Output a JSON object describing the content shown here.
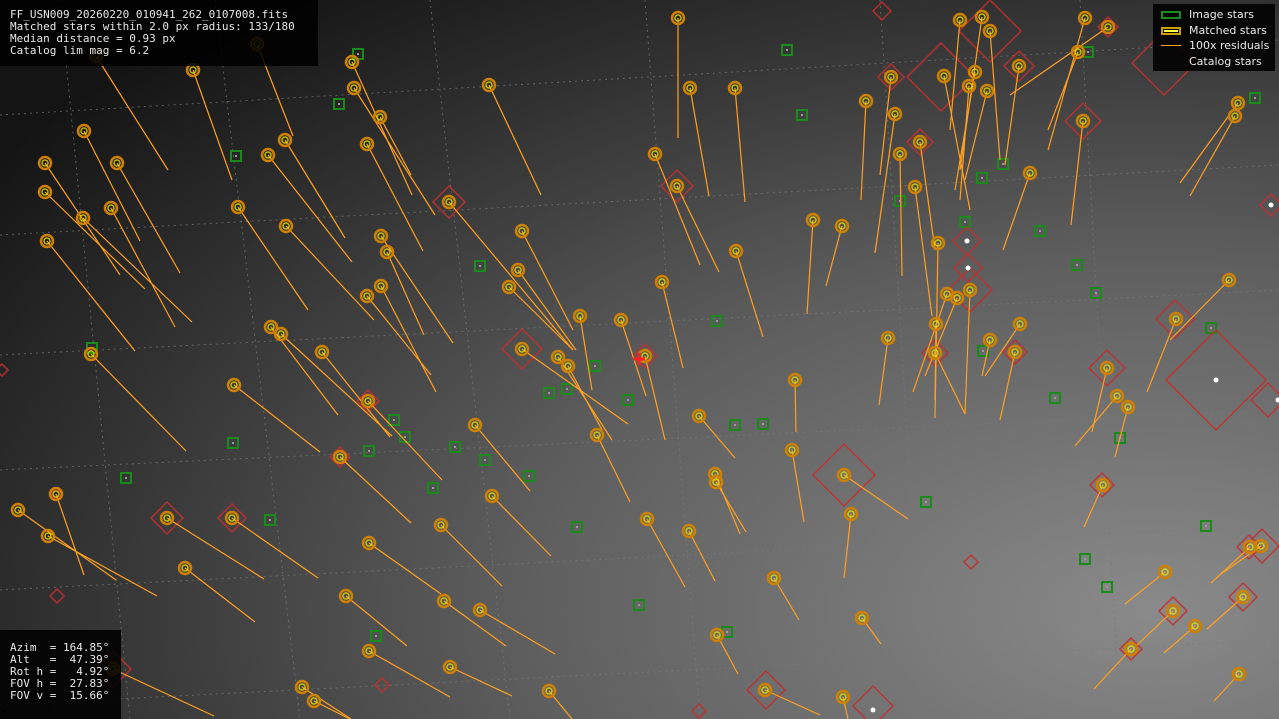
{
  "info": {
    "lines": [
      "FF_USN009_20260220_010941_262_0107008.fits",
      "Matched stars within 2.0 px radius: 133/180",
      "Median distance = 0.93 px",
      "Catalog lim mag = 6.2"
    ]
  },
  "legend": {
    "image_stars": "Image stars",
    "matched_stars": "Matched stars",
    "residuals": "100x residuals",
    "catalog_stars": "Catalog stars"
  },
  "coords": {
    "lines": [
      "Azim  = 164.85°",
      "Alt   =  47.39°",
      "Rot h =   4.92°",
      "FOV h =  27.83°",
      "FOV v =  15.66°"
    ]
  },
  "colors": {
    "image_star": "#1a8a1a",
    "matched_ring_outer": "#d08000",
    "matched_ring_inner": "#e8e000",
    "residual": "#ffa020",
    "catalog_star": "#c03030",
    "grid": "#7a7a7a",
    "marker": "#ff2020"
  },
  "matched_stars": [
    [
      678,
      18
    ],
    [
      960,
      20
    ],
    [
      982,
      17
    ],
    [
      990,
      31
    ],
    [
      1085,
      18
    ],
    [
      1108,
      27
    ],
    [
      1078,
      52
    ],
    [
      1019,
      66
    ],
    [
      944,
      76
    ],
    [
      975,
      72
    ],
    [
      969,
      86
    ],
    [
      987,
      91
    ],
    [
      866,
      101
    ],
    [
      891,
      77
    ],
    [
      895,
      114
    ],
    [
      920,
      142
    ],
    [
      900,
      154
    ],
    [
      1083,
      121
    ],
    [
      1030,
      173
    ],
    [
      915,
      187
    ],
    [
      938,
      243
    ],
    [
      947,
      294
    ],
    [
      957,
      298
    ],
    [
      970,
      290
    ],
    [
      936,
      324
    ],
    [
      935,
      353
    ],
    [
      1015,
      352
    ],
    [
      990,
      340
    ],
    [
      1020,
      324
    ],
    [
      888,
      338
    ],
    [
      795,
      380
    ],
    [
      842,
      226
    ],
    [
      813,
      220
    ],
    [
      735,
      88
    ],
    [
      690,
      88
    ],
    [
      655,
      154
    ],
    [
      677,
      186
    ],
    [
      736,
      251
    ],
    [
      662,
      282
    ],
    [
      621,
      320
    ],
    [
      645,
      356
    ],
    [
      558,
      357
    ],
    [
      568,
      366
    ],
    [
      580,
      316
    ],
    [
      522,
      231
    ],
    [
      518,
      270
    ],
    [
      509,
      287
    ],
    [
      449,
      202
    ],
    [
      489,
      85
    ],
    [
      352,
      62
    ],
    [
      354,
      88
    ],
    [
      380,
      117
    ],
    [
      367,
      144
    ],
    [
      285,
      140
    ],
    [
      268,
      155
    ],
    [
      238,
      207
    ],
    [
      286,
      226
    ],
    [
      381,
      236
    ],
    [
      387,
      252
    ],
    [
      381,
      286
    ],
    [
      367,
      296
    ],
    [
      193,
      70
    ],
    [
      257,
      44
    ],
    [
      96,
      56
    ],
    [
      84,
      131
    ],
    [
      117,
      163
    ],
    [
      45,
      163
    ],
    [
      45,
      192
    ],
    [
      83,
      218
    ],
    [
      111,
      208
    ],
    [
      47,
      241
    ],
    [
      91,
      354
    ],
    [
      271,
      327
    ],
    [
      281,
      334
    ],
    [
      322,
      352
    ],
    [
      234,
      385
    ],
    [
      368,
      401
    ],
    [
      340,
      457
    ],
    [
      475,
      425
    ],
    [
      522,
      349
    ],
    [
      597,
      435
    ],
    [
      699,
      416
    ],
    [
      715,
      474
    ],
    [
      716,
      482
    ],
    [
      792,
      450
    ],
    [
      844,
      475
    ],
    [
      851,
      514
    ],
    [
      689,
      531
    ],
    [
      647,
      519
    ],
    [
      774,
      578
    ],
    [
      717,
      635
    ],
    [
      862,
      618
    ],
    [
      843,
      697
    ],
    [
      765,
      690
    ],
    [
      549,
      691
    ],
    [
      450,
      667
    ],
    [
      480,
      610
    ],
    [
      444,
      601
    ],
    [
      369,
      651
    ],
    [
      346,
      596
    ],
    [
      369,
      543
    ],
    [
      441,
      525
    ],
    [
      492,
      496
    ],
    [
      302,
      687
    ],
    [
      314,
      701
    ],
    [
      232,
      518
    ],
    [
      167,
      518
    ],
    [
      185,
      568
    ],
    [
      56,
      494
    ],
    [
      48,
      536
    ],
    [
      18,
      510
    ],
    [
      113,
      669
    ],
    [
      1238,
      103
    ],
    [
      1235,
      116
    ],
    [
      1229,
      280
    ],
    [
      1176,
      319
    ],
    [
      1107,
      368
    ],
    [
      1117,
      396
    ],
    [
      1128,
      407
    ],
    [
      1103,
      485
    ],
    [
      1165,
      572
    ],
    [
      1250,
      547
    ],
    [
      1261,
      546
    ],
    [
      1243,
      597
    ],
    [
      1173,
      611
    ],
    [
      1195,
      626
    ],
    [
      1131,
      649
    ],
    [
      1239,
      674
    ]
  ],
  "residuals": [
    [
      678,
      18,
      678,
      138
    ],
    [
      960,
      20,
      950,
      130
    ],
    [
      982,
      17,
      960,
      170
    ],
    [
      990,
      31,
      1000,
      160
    ],
    [
      1085,
      18,
      1048,
      150
    ],
    [
      1108,
      27,
      1010,
      95
    ],
    [
      1078,
      52,
      1048,
      130
    ],
    [
      1019,
      66,
      1005,
      165
    ],
    [
      944,
      76,
      970,
      210
    ],
    [
      975,
      72,
      955,
      190
    ],
    [
      969,
      86,
      960,
      200
    ],
    [
      987,
      91,
      965,
      180
    ],
    [
      866,
      101,
      861,
      200
    ],
    [
      891,
      77,
      880,
      175
    ],
    [
      895,
      114,
      875,
      253
    ],
    [
      920,
      142,
      935,
      250
    ],
    [
      900,
      154,
      902,
      276
    ],
    [
      1083,
      121,
      1071,
      225
    ],
    [
      1030,
      173,
      1003,
      250
    ],
    [
      915,
      187,
      932,
      316
    ],
    [
      938,
      243,
      935,
      418
    ],
    [
      947,
      294,
      913,
      392
    ],
    [
      957,
      298,
      925,
      376
    ],
    [
      970,
      290,
      965,
      414
    ],
    [
      936,
      324,
      935,
      400
    ],
    [
      935,
      353,
      965,
      414
    ],
    [
      1015,
      352,
      1000,
      420
    ],
    [
      990,
      340,
      982,
      376
    ],
    [
      1020,
      324,
      985,
      376
    ],
    [
      888,
      338,
      879,
      405
    ],
    [
      795,
      380,
      796,
      432
    ],
    [
      842,
      226,
      826,
      286
    ],
    [
      813,
      220,
      807,
      314
    ],
    [
      735,
      88,
      745,
      202
    ],
    [
      690,
      88,
      709,
      196
    ],
    [
      655,
      154,
      700,
      265
    ],
    [
      677,
      186,
      719,
      272
    ],
    [
      736,
      251,
      763,
      337
    ],
    [
      662,
      282,
      683,
      368
    ],
    [
      621,
      320,
      646,
      396
    ],
    [
      645,
      356,
      665,
      440
    ],
    [
      558,
      357,
      612,
      440
    ],
    [
      568,
      366,
      602,
      430
    ],
    [
      580,
      316,
      592,
      390
    ],
    [
      522,
      231,
      573,
      330
    ],
    [
      518,
      270,
      576,
      350
    ],
    [
      509,
      287,
      573,
      350
    ],
    [
      449,
      202,
      573,
      350
    ],
    [
      489,
      85,
      541,
      195
    ],
    [
      352,
      62,
      412,
      195
    ],
    [
      354,
      88,
      435,
      215
    ],
    [
      380,
      117,
      411,
      175
    ],
    [
      367,
      144,
      423,
      251
    ],
    [
      285,
      140,
      345,
      238
    ],
    [
      268,
      155,
      352,
      262
    ],
    [
      238,
      207,
      308,
      310
    ],
    [
      286,
      226,
      374,
      320
    ],
    [
      381,
      236,
      453,
      343
    ],
    [
      387,
      252,
      424,
      335
    ],
    [
      381,
      286,
      436,
      392
    ],
    [
      367,
      296,
      431,
      375
    ],
    [
      193,
      70,
      232,
      180
    ],
    [
      257,
      44,
      293,
      136
    ],
    [
      96,
      56,
      168,
      170
    ],
    [
      84,
      131,
      140,
      241
    ],
    [
      117,
      163,
      180,
      273
    ],
    [
      45,
      163,
      120,
      275
    ],
    [
      45,
      192,
      145,
      289
    ],
    [
      83,
      218,
      192,
      322
    ],
    [
      111,
      208,
      175,
      327
    ],
    [
      47,
      241,
      135,
      351
    ],
    [
      91,
      354,
      186,
      451
    ],
    [
      271,
      327,
      338,
      415
    ],
    [
      281,
      334,
      392,
      436
    ],
    [
      322,
      352,
      390,
      437
    ],
    [
      234,
      385,
      320,
      452
    ],
    [
      368,
      401,
      442,
      480
    ],
    [
      340,
      457,
      411,
      523
    ],
    [
      475,
      425,
      530,
      491
    ],
    [
      522,
      349,
      628,
      424
    ],
    [
      597,
      435,
      630,
      502
    ],
    [
      699,
      416,
      735,
      458
    ],
    [
      715,
      474,
      740,
      534
    ],
    [
      716,
      482,
      746,
      532
    ],
    [
      792,
      450,
      804,
      522
    ],
    [
      844,
      475,
      908,
      519
    ],
    [
      851,
      514,
      844,
      578
    ],
    [
      689,
      531,
      715,
      581
    ],
    [
      647,
      519,
      685,
      587
    ],
    [
      774,
      578,
      799,
      620
    ],
    [
      717,
      635,
      738,
      674
    ],
    [
      862,
      618,
      881,
      644
    ],
    [
      843,
      697,
      848,
      719
    ],
    [
      765,
      690,
      820,
      715
    ],
    [
      549,
      691,
      572,
      719
    ],
    [
      450,
      667,
      512,
      696
    ],
    [
      480,
      610,
      555,
      654
    ],
    [
      444,
      601,
      506,
      646
    ],
    [
      369,
      651,
      450,
      697
    ],
    [
      346,
      596,
      407,
      646
    ],
    [
      369,
      543,
      441,
      594
    ],
    [
      441,
      525,
      502,
      586
    ],
    [
      492,
      496,
      551,
      556
    ],
    [
      302,
      687,
      351,
      719
    ],
    [
      314,
      701,
      350,
      719
    ],
    [
      232,
      518,
      318,
      578
    ],
    [
      167,
      518,
      264,
      579
    ],
    [
      185,
      568,
      255,
      622
    ],
    [
      56,
      494,
      84,
      575
    ],
    [
      48,
      536,
      157,
      596
    ],
    [
      18,
      510,
      116,
      580
    ],
    [
      113,
      669,
      214,
      716
    ],
    [
      1238,
      103,
      1180,
      183
    ],
    [
      1235,
      116,
      1190,
      196
    ],
    [
      1229,
      280,
      1170,
      340
    ],
    [
      1176,
      319,
      1147,
      392
    ],
    [
      1107,
      368,
      1092,
      432
    ],
    [
      1117,
      396,
      1075,
      446
    ],
    [
      1128,
      407,
      1115,
      457
    ],
    [
      1103,
      485,
      1084,
      527
    ],
    [
      1165,
      572,
      1125,
      604
    ],
    [
      1250,
      547,
      1211,
      583
    ],
    [
      1261,
      546,
      1221,
      574
    ],
    [
      1243,
      597,
      1207,
      629
    ],
    [
      1173,
      611,
      1137,
      645
    ],
    [
      1195,
      626,
      1164,
      653
    ],
    [
      1131,
      649,
      1094,
      689
    ],
    [
      1239,
      674,
      1214,
      701
    ]
  ],
  "image_stars": [
    [
      358,
      54
    ],
    [
      787,
      50
    ],
    [
      339,
      104
    ],
    [
      802,
      115
    ],
    [
      236,
      156
    ],
    [
      1003,
      164
    ],
    [
      982,
      178
    ],
    [
      900,
      201
    ],
    [
      965,
      222
    ],
    [
      1040,
      231
    ],
    [
      1077,
      265
    ],
    [
      480,
      266
    ],
    [
      1096,
      293
    ],
    [
      717,
      321
    ],
    [
      1211,
      328
    ],
    [
      92,
      348
    ],
    [
      983,
      351
    ],
    [
      595,
      366
    ],
    [
      549,
      393
    ],
    [
      567,
      389
    ],
    [
      628,
      400
    ],
    [
      1055,
      398
    ],
    [
      735,
      425
    ],
    [
      763,
      424
    ],
    [
      394,
      420
    ],
    [
      405,
      437
    ],
    [
      233,
      443
    ],
    [
      455,
      447
    ],
    [
      369,
      451
    ],
    [
      1120,
      438
    ],
    [
      485,
      460
    ],
    [
      529,
      476
    ],
    [
      126,
      478
    ],
    [
      433,
      488
    ],
    [
      926,
      502
    ],
    [
      270,
      520
    ],
    [
      577,
      527
    ],
    [
      1206,
      526
    ],
    [
      1085,
      559
    ],
    [
      1107,
      587
    ],
    [
      639,
      605
    ],
    [
      727,
      632
    ],
    [
      376,
      636
    ],
    [
      1255,
      98
    ],
    [
      1088,
      52
    ]
  ],
  "catalog_stars": [
    [
      449,
      202,
      16
    ],
    [
      522,
      349,
      20
    ],
    [
      368,
      401,
      11
    ],
    [
      340,
      457,
      10
    ],
    [
      167,
      518,
      16
    ],
    [
      232,
      518,
      14
    ],
    [
      844,
      475,
      31
    ],
    [
      766,
      690,
      19
    ],
    [
      873,
      706,
      20
    ],
    [
      1216,
      380,
      50
    ],
    [
      1175,
      319,
      19
    ],
    [
      1107,
      368,
      18
    ],
    [
      1102,
      485,
      12
    ],
    [
      1249,
      547,
      12
    ],
    [
      1262,
      546,
      17
    ],
    [
      1243,
      597,
      14
    ],
    [
      1173,
      611,
      14
    ],
    [
      1131,
      649,
      11
    ],
    [
      1268,
      400,
      17
    ],
    [
      1271,
      205,
      11
    ],
    [
      1083,
      121,
      18
    ],
    [
      1019,
      66,
      15
    ],
    [
      1164,
      63,
      32
    ],
    [
      990,
      31,
      31
    ],
    [
      941,
      77,
      34
    ],
    [
      891,
      77,
      13
    ],
    [
      920,
      142,
      13
    ],
    [
      967,
      241,
      14
    ],
    [
      968,
      268,
      14
    ],
    [
      970,
      290,
      22
    ],
    [
      1015,
      352,
      12
    ],
    [
      935,
      353,
      13
    ],
    [
      677,
      186,
      16
    ],
    [
      645,
      356,
      12
    ],
    [
      882,
      11,
      9
    ],
    [
      971,
      562,
      7
    ],
    [
      57,
      596,
      7
    ],
    [
      2,
      370,
      6
    ],
    [
      382,
      685,
      7
    ],
    [
      699,
      711,
      7
    ],
    [
      113,
      669,
      18
    ],
    [
      56,
      494,
      6
    ],
    [
      1108,
      27,
      10
    ]
  ],
  "marker": [
    639,
    359
  ]
}
